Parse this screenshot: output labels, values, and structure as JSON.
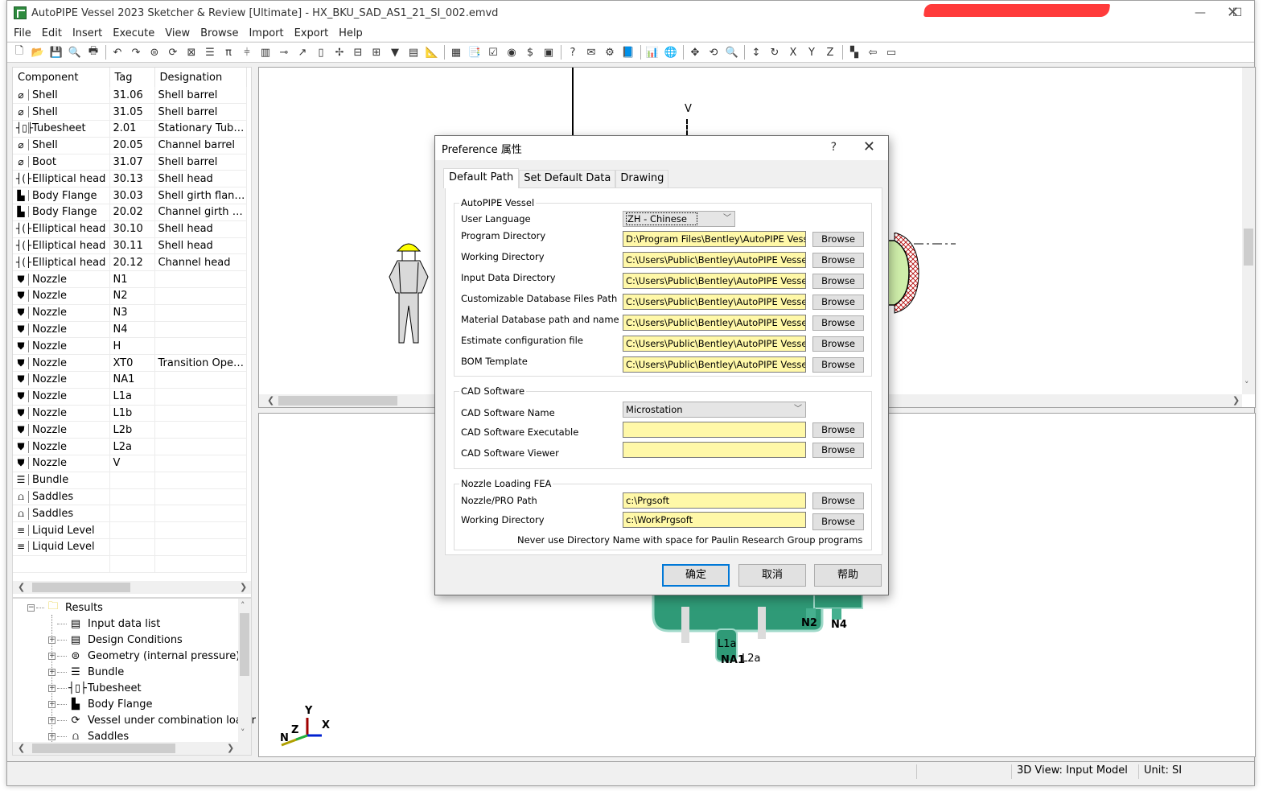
{
  "window": {
    "title": "AutoPIPE Vessel 2023 Sketcher & Review [Ultimate] - HX_BKU_SAD_AS1_21_SI_002.emvd",
    "minimize_icon": "minimize-icon",
    "maximize_icon": "maximize-icon",
    "close_icon": "close-icon"
  },
  "menu": [
    "File",
    "Edit",
    "Insert",
    "Execute",
    "View",
    "Browse",
    "Import",
    "Export",
    "Help"
  ],
  "toolbar": {
    "groups": [
      [
        {
          "name": "new-file-icon",
          "glyph": "🗋"
        },
        {
          "name": "open-folder-icon",
          "glyph": "📂"
        },
        {
          "name": "save-icon",
          "glyph": "💾"
        },
        {
          "name": "print-preview-icon",
          "glyph": "🔍"
        },
        {
          "name": "print-icon",
          "glyph": "🖶"
        }
      ],
      [
        {
          "name": "undo-icon",
          "glyph": "↶"
        },
        {
          "name": "redo-icon",
          "glyph": "↷"
        },
        {
          "name": "geometry-icon",
          "glyph": "⊜"
        },
        {
          "name": "combination-load-icon",
          "glyph": "⟳"
        },
        {
          "name": "box-icon",
          "glyph": "⊠"
        },
        {
          "name": "lines-icon",
          "glyph": "☰"
        },
        {
          "name": "support-icon",
          "glyph": "π"
        },
        {
          "name": "nozzle-flange-icon",
          "glyph": "⫩"
        },
        {
          "name": "bundle-icon",
          "glyph": "▥"
        },
        {
          "name": "nozzle-icon",
          "glyph": "⊸"
        },
        {
          "name": "arrow-tool-icon",
          "glyph": "↗"
        },
        {
          "name": "tube-icon",
          "glyph": "▯"
        },
        {
          "name": "cross-icon",
          "glyph": "✢"
        },
        {
          "name": "tray-icon",
          "glyph": "⊟"
        },
        {
          "name": "ladder-icon",
          "glyph": "⊞"
        },
        {
          "name": "skirt-icon",
          "glyph": "▼"
        },
        {
          "name": "list-icon",
          "glyph": "▤"
        },
        {
          "name": "ruler-icon",
          "glyph": "📐"
        }
      ],
      [
        {
          "name": "calculator-icon",
          "glyph": "▦"
        },
        {
          "name": "report-icon",
          "glyph": "📑"
        },
        {
          "name": "checklist-icon",
          "glyph": "☑"
        },
        {
          "name": "eye-icon",
          "glyph": "◉"
        },
        {
          "name": "cost-icon",
          "glyph": "$"
        },
        {
          "name": "database-icon",
          "glyph": "▣"
        }
      ],
      [
        {
          "name": "help-icon",
          "glyph": "?"
        },
        {
          "name": "mail-icon",
          "glyph": "✉"
        },
        {
          "name": "settings-icon",
          "glyph": "⚙"
        },
        {
          "name": "book-icon",
          "glyph": "📘"
        }
      ],
      [
        {
          "name": "chart-icon",
          "glyph": "📊"
        },
        {
          "name": "globe-icon",
          "glyph": "🌐"
        }
      ],
      [
        {
          "name": "pan-icon",
          "glyph": "✥"
        },
        {
          "name": "rotate-icon",
          "glyph": "⟲"
        },
        {
          "name": "zoom-icon",
          "glyph": "🔍"
        }
      ],
      [
        {
          "name": "vertical-view-icon",
          "glyph": "↕"
        },
        {
          "name": "rotate-view-icon",
          "glyph": "↻"
        },
        {
          "name": "rotate-x-icon",
          "glyph": "X"
        },
        {
          "name": "rotate-y-icon",
          "glyph": "Y"
        },
        {
          "name": "rotate-z-icon",
          "glyph": "Z"
        }
      ],
      [
        {
          "name": "layer-icon",
          "glyph": "▚"
        },
        {
          "name": "import-icon",
          "glyph": "⇦"
        },
        {
          "name": "window-icon",
          "glyph": "▭"
        }
      ]
    ]
  },
  "component_list": {
    "headers": [
      "Component",
      "Tag",
      "Designation"
    ],
    "rows": [
      {
        "icon": "shell-icon",
        "glyph": "⌀",
        "component": "Shell",
        "tag": "31.06",
        "designation": "Shell barrel"
      },
      {
        "icon": "shell-icon",
        "glyph": "⌀",
        "component": "Shell",
        "tag": "31.05",
        "designation": "Shell barrel"
      },
      {
        "icon": "tubesheet-icon",
        "glyph": "┤▯├",
        "component": "Tubesheet",
        "tag": "2.01",
        "designation": "Stationary Tubes..."
      },
      {
        "icon": "shell-icon",
        "glyph": "⌀",
        "component": "Shell",
        "tag": "20.05",
        "designation": "Channel barrel"
      },
      {
        "icon": "shell-icon",
        "glyph": "⌀",
        "component": "Boot",
        "tag": "31.07",
        "designation": "Shell barrel"
      },
      {
        "icon": "elliptical-head-icon",
        "glyph": "┤(├",
        "component": "Elliptical head",
        "tag": "30.13",
        "designation": "Shell head"
      },
      {
        "icon": "body-flange-icon",
        "glyph": "▙",
        "component": "Body Flange",
        "tag": "30.03",
        "designation": "Shell girth flange"
      },
      {
        "icon": "body-flange-icon",
        "glyph": "▙",
        "component": "Body Flange",
        "tag": "20.02",
        "designation": "Channel girth fla..."
      },
      {
        "icon": "elliptical-head-icon",
        "glyph": "┤(├",
        "component": "Elliptical head",
        "tag": "30.10",
        "designation": "Shell head"
      },
      {
        "icon": "elliptical-head-icon",
        "glyph": "┤(├",
        "component": "Elliptical head",
        "tag": "30.11",
        "designation": "Shell head"
      },
      {
        "icon": "elliptical-head-icon",
        "glyph": "┤(├",
        "component": "Elliptical head",
        "tag": "20.12",
        "designation": "Channel head"
      },
      {
        "icon": "nozzle-icon",
        "glyph": "⛊",
        "component": "Nozzle",
        "tag": "N1",
        "designation": ""
      },
      {
        "icon": "nozzle-icon",
        "glyph": "⛊",
        "component": "Nozzle",
        "tag": "N2",
        "designation": ""
      },
      {
        "icon": "nozzle-icon",
        "glyph": "⛊",
        "component": "Nozzle",
        "tag": "N3",
        "designation": ""
      },
      {
        "icon": "nozzle-icon",
        "glyph": "⛊",
        "component": "Nozzle",
        "tag": "N4",
        "designation": ""
      },
      {
        "icon": "nozzle-icon",
        "glyph": "⛊",
        "component": "Nozzle",
        "tag": "H",
        "designation": ""
      },
      {
        "icon": "nozzle-icon",
        "glyph": "⛊",
        "component": "Nozzle",
        "tag": "XT0",
        "designation": "Transition Openi..."
      },
      {
        "icon": "nozzle-icon",
        "glyph": "⛊",
        "component": "Nozzle",
        "tag": "NA1",
        "designation": ""
      },
      {
        "icon": "nozzle-icon",
        "glyph": "⛊",
        "component": "Nozzle",
        "tag": "L1a",
        "designation": ""
      },
      {
        "icon": "nozzle-icon",
        "glyph": "⛊",
        "component": "Nozzle",
        "tag": "L1b",
        "designation": ""
      },
      {
        "icon": "nozzle-icon",
        "glyph": "⛊",
        "component": "Nozzle",
        "tag": "L2b",
        "designation": ""
      },
      {
        "icon": "nozzle-icon",
        "glyph": "⛊",
        "component": "Nozzle",
        "tag": "L2a",
        "designation": ""
      },
      {
        "icon": "nozzle-icon",
        "glyph": "⛊",
        "component": "Nozzle",
        "tag": "V",
        "designation": ""
      },
      {
        "icon": "bundle-icon",
        "glyph": "☰",
        "component": "Bundle",
        "tag": "",
        "designation": ""
      },
      {
        "icon": "saddles-icon",
        "glyph": "⩍",
        "component": "Saddles",
        "tag": "",
        "designation": ""
      },
      {
        "icon": "saddles-icon",
        "glyph": "⩍",
        "component": "Saddles",
        "tag": "",
        "designation": ""
      },
      {
        "icon": "liquid-level-icon",
        "glyph": "≡",
        "component": "Liquid Level",
        "tag": "",
        "designation": ""
      },
      {
        "icon": "liquid-level-icon",
        "glyph": "≡",
        "component": "Liquid Level",
        "tag": "",
        "designation": ""
      },
      {
        "icon": "",
        "glyph": "",
        "component": "",
        "tag": "",
        "designation": ""
      }
    ]
  },
  "results_tree": {
    "root": {
      "label": "Results",
      "icon": "folder-icon",
      "expanded": true
    },
    "items": [
      {
        "label": "Input data list",
        "icon": "input-list-icon",
        "glyph": "▤",
        "expandable": false
      },
      {
        "label": "Design Conditions",
        "icon": "design-conditions-icon",
        "glyph": "▤",
        "expandable": true
      },
      {
        "label": "Geometry (internal pressure)",
        "icon": "geometry-icon",
        "glyph": "⊜",
        "expandable": true
      },
      {
        "label": "Bundle",
        "icon": "bundle-icon",
        "glyph": "☰",
        "expandable": true
      },
      {
        "label": "Tubesheet",
        "icon": "tubesheet-icon",
        "glyph": "┤▯├",
        "expandable": true
      },
      {
        "label": "Body Flange",
        "icon": "body-flange-icon",
        "glyph": "▙",
        "expandable": true
      },
      {
        "label": "Vessel under combination loadir",
        "icon": "combination-load-icon",
        "glyph": "⟳",
        "expandable": true
      },
      {
        "label": "Saddles",
        "icon": "saddles-icon",
        "glyph": "⩍",
        "expandable": true
      }
    ]
  },
  "viewport_top": {
    "nozzle_label": "V"
  },
  "viewport_bottom": {
    "nozzle_labels": [
      "N2",
      "N4",
      "L1a",
      "NA1",
      "L2a"
    ],
    "axes": {
      "x": "X",
      "y": "Y",
      "z": "Z",
      "n": "N"
    }
  },
  "status_bar": {
    "view": "3D View: Input Model",
    "unit": "Unit: SI"
  },
  "dialog": {
    "title": "Preference 属性",
    "help_label": "?",
    "tabs": [
      {
        "label": "Default Path",
        "active": true
      },
      {
        "label": "Set Default Data",
        "active": false
      },
      {
        "label": "Drawing",
        "active": false
      }
    ],
    "autopipe_group": {
      "title": "AutoPIPE Vessel",
      "user_language_label": "User Language",
      "user_language_value": "ZH - Chinese",
      "paths": [
        {
          "label": "Program Directory",
          "value": "D:\\Program Files\\Bentley\\AutoPIPE Vessel\\AutoPIPE Vessel"
        },
        {
          "label": "Working Directory",
          "value": "C:\\Users\\Public\\Bentley\\AutoPIPE Vessel\\AutoPIPE Vessel"
        },
        {
          "label": "Input Data Directory",
          "value": "C:\\Users\\Public\\Bentley\\AutoPIPE Vessel\\AutoPIPE Vessel"
        },
        {
          "label": "Customizable Database Files Path",
          "value": "C:\\Users\\Public\\Bentley\\AutoPIPE Vessel\\AutoPIPE Vessel"
        },
        {
          "label": "Material Database path and name",
          "value": "C:\\Users\\Public\\Bentley\\AutoPIPE Vessel\\AutoPIPE Vessel"
        },
        {
          "label": "Estimate configuration file",
          "value": "C:\\Users\\Public\\Bentley\\AutoPIPE Vessel\\AutoPIPE Vessel"
        },
        {
          "label": "BOM Template",
          "value": "C:\\Users\\Public\\Bentley\\AutoPIPE Vessel\\AutoPIPE Vessel"
        }
      ]
    },
    "cad_group": {
      "title": "CAD Software",
      "name_label": "CAD Software Name",
      "name_value": "Microstation",
      "executable_label": "CAD Software Executable",
      "executable_value": "",
      "viewer_label": "CAD Software Viewer",
      "viewer_value": ""
    },
    "fea_group": {
      "title": "Nozzle Loading FEA",
      "pro_path_label": "Nozzle/PRO Path",
      "pro_path_value": "c:\\Prgsoft",
      "working_dir_label": "Working Directory",
      "working_dir_value": "c:\\WorkPrgsoft",
      "note": "Never use Directory Name with space for Paulin Research Group programs"
    },
    "browse_label": "Browse",
    "ok_label": "确定",
    "cancel_label": "取消",
    "help_button_label": "帮助"
  }
}
